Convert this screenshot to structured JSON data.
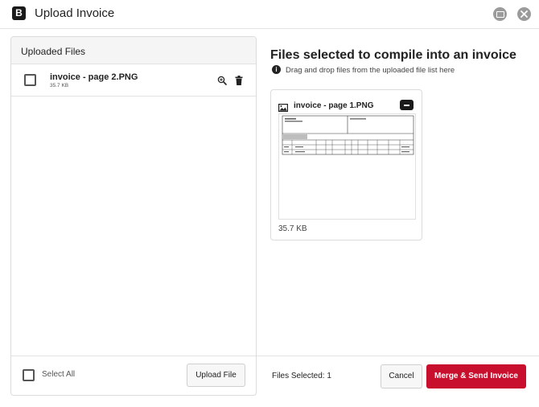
{
  "window": {
    "logo_letter": "B",
    "title": "Upload Invoice",
    "restore_icon": "window-restore-icon",
    "close_icon": "close-icon"
  },
  "uploaded_panel": {
    "title": "Uploaded Files",
    "files": [
      {
        "name": "invoice - page 2.PNG",
        "size": "35.7 KB",
        "checked": false
      }
    ],
    "select_all_label": "Select All",
    "upload_button": "Upload File"
  },
  "compile_panel": {
    "title": "Files selected to compile into an invoice",
    "subtitle": "Drag and drop files from the uploaded file list here",
    "selected_files": [
      {
        "name": "invoice - page 1.PNG",
        "size": "35.7 KB"
      }
    ]
  },
  "footer": {
    "files_selected_label": "Files Selected: 1",
    "cancel_button": "Cancel",
    "merge_button": "Merge & Send Invoice"
  },
  "colors": {
    "primary": "#c8102e",
    "dark": "#1a1a1a",
    "border": "#dcdcdc"
  }
}
